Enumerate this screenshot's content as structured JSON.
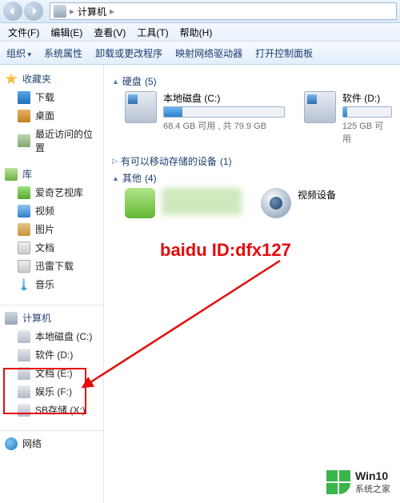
{
  "titlebar": {
    "location_label": "计算机",
    "sep": "▸"
  },
  "menubar": {
    "file": "文件(F)",
    "edit": "编辑(E)",
    "view": "查看(V)",
    "tools": "工具(T)",
    "help": "帮助(H)"
  },
  "toolbar": {
    "organize": "组织",
    "sysprops": "系统属性",
    "uninstall": "卸载或更改程序",
    "mapnet": "映射网络驱动器",
    "cpanel": "打开控制面板"
  },
  "sidebar": {
    "fav": "收藏夹",
    "fav_items": [
      "下载",
      "桌面",
      "最近访问的位置"
    ],
    "lib": "库",
    "lib_items": [
      "爱奇艺视库",
      "视频",
      "图片",
      "文档",
      "迅雷下载",
      "音乐"
    ],
    "pc": "计算机",
    "pc_items": [
      "本地磁盘 (C:)",
      "软件 (D:)",
      "文档 (E:)",
      "娱乐 (F:)",
      "SB存储 (X:)"
    ],
    "net": "网络"
  },
  "content": {
    "hdd": {
      "title": "硬盘",
      "count": "(5)"
    },
    "drive_c": {
      "name": "本地磁盘 (C:)",
      "info": "68.4 GB 可用 , 共 79.9 GB",
      "used_pct": 15
    },
    "drive_d": {
      "name": "软件 (D:)",
      "info": "125 GB 可用",
      "used_pct": 8
    },
    "removable": {
      "title": "有可以移动存储的设备",
      "count": "(1)"
    },
    "other": {
      "title": "其他",
      "count": "(4)"
    },
    "cam": "视频设备"
  },
  "annotation": {
    "text": "baidu ID:dfx127"
  },
  "watermark": {
    "brand": "Win10",
    "site": "系统之家"
  }
}
